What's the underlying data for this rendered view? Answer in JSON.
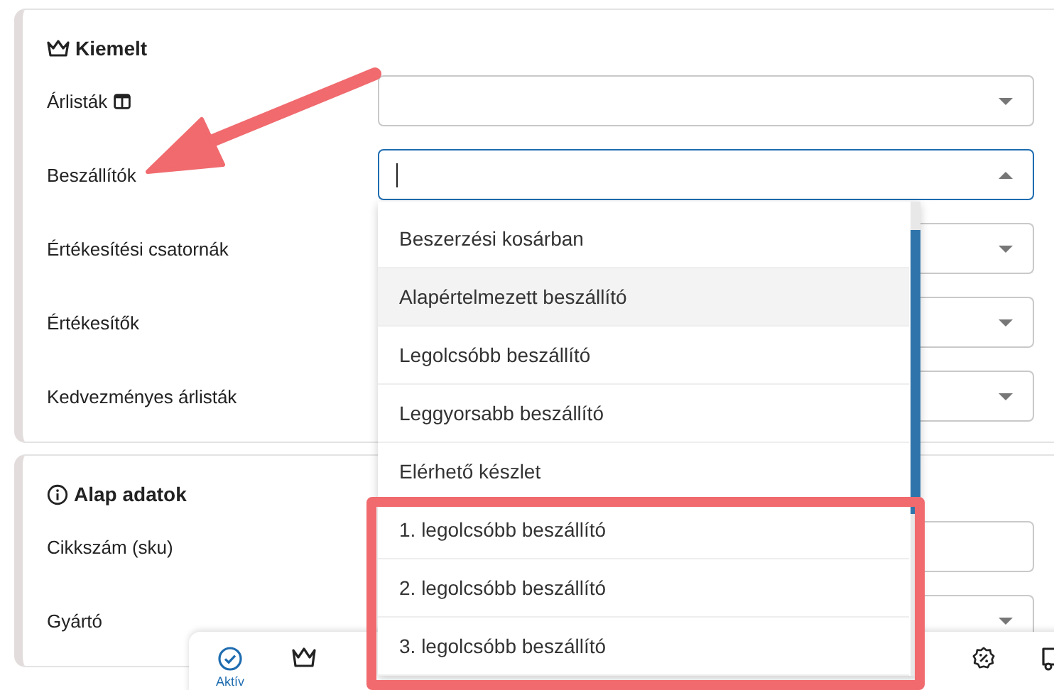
{
  "sections": [
    {
      "title": "Kiemelt",
      "kind": "crown",
      "fields": [
        {
          "label": "Árlisták",
          "label_icon": true,
          "kind": "select",
          "focused": false
        },
        {
          "label": "Beszállítók",
          "kind": "select",
          "focused": true
        },
        {
          "label": "Értékesítési csatornák",
          "kind": "select",
          "focused": false
        },
        {
          "label": "Értékesítők",
          "kind": "select",
          "focused": false
        },
        {
          "label": "Kedvezményes árlisták",
          "kind": "select",
          "focused": false
        }
      ]
    },
    {
      "title": "Alap adatok",
      "kind": "info",
      "fields": [
        {
          "label": "Cikkszám (sku)",
          "kind": "text",
          "focused": false
        },
        {
          "label": "Gyártó",
          "kind": "select",
          "focused": false
        }
      ]
    }
  ],
  "dropdown": {
    "options": [
      {
        "label": "Beszerzési kosárban",
        "selected": false
      },
      {
        "label": "Alapértelmezett beszállító",
        "selected": true
      },
      {
        "label": "Legolcsóbb beszállító",
        "selected": false
      },
      {
        "label": "Leggyorsabb beszállító",
        "selected": false
      },
      {
        "label": "Elérhető készlet",
        "selected": false
      },
      {
        "label": "1. legolcsóbb beszállító",
        "selected": false
      },
      {
        "label": "2. legolcsóbb beszállító",
        "selected": false
      },
      {
        "label": "3. legolcsóbb beszállító",
        "selected": false
      }
    ]
  },
  "bottom_nav": {
    "left": [
      {
        "kind": "check",
        "label": "Aktív",
        "selected": true
      },
      {
        "kind": "crown",
        "selected": false
      }
    ],
    "right": [
      {
        "kind": "percent",
        "selected": false
      },
      {
        "kind": "truck",
        "selected": false
      }
    ]
  }
}
